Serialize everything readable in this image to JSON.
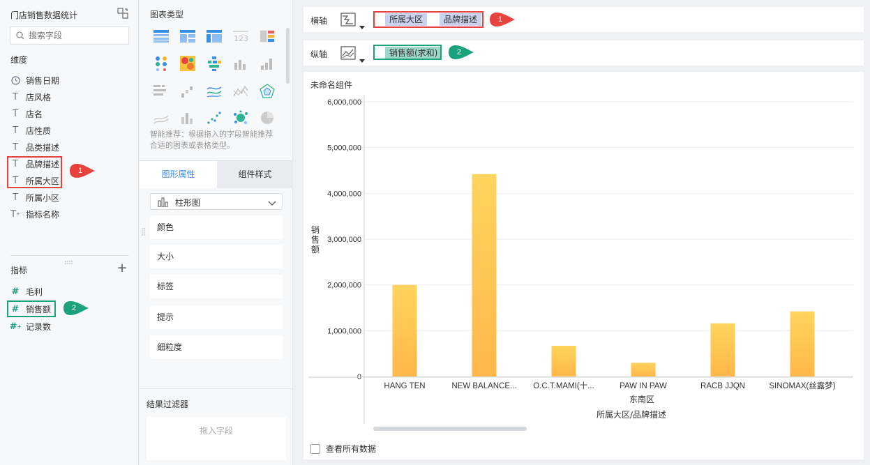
{
  "dataset": {
    "title": "门店销售数据统计"
  },
  "search": {
    "placeholder": "搜索字段"
  },
  "dimensions": {
    "label": "维度",
    "items": [
      {
        "label": "销售日期",
        "icon": "clock-icon"
      },
      {
        "label": "店风格",
        "icon": "text-type-icon"
      },
      {
        "label": "店名",
        "icon": "text-type-icon"
      },
      {
        "label": "店性质",
        "icon": "text-type-icon"
      },
      {
        "label": "品类描述",
        "icon": "text-type-icon"
      },
      {
        "label": "品牌描述",
        "icon": "text-type-icon"
      },
      {
        "label": "所属大区",
        "icon": "text-type-icon"
      },
      {
        "label": "所属小区",
        "icon": "text-type-icon"
      },
      {
        "label": "指标名称",
        "icon": "text-type-icon"
      }
    ]
  },
  "measures": {
    "label": "指标",
    "items": [
      {
        "label": "毛利",
        "icon": "number-type-icon"
      },
      {
        "label": "销售额",
        "icon": "number-type-icon"
      },
      {
        "label": "记录数",
        "icon": "number-type-icon"
      }
    ]
  },
  "badges": {
    "one": "1",
    "two": "2"
  },
  "chart_types": {
    "label": "图表类型",
    "recommend": "智能推荐：根据拖入的字段智能推荐合适的图表或表格类型。"
  },
  "tabs": {
    "graph_props": "图形属性",
    "component_style": "组件样式"
  },
  "chart_select": {
    "value": "柱形图"
  },
  "properties": [
    "颜色",
    "大小",
    "标签",
    "提示",
    "细粒度"
  ],
  "result_filter": {
    "label": "结果过滤器",
    "drop_hint": "拖入字段"
  },
  "x_axis": {
    "label": "横轴",
    "fields": [
      "所属大区",
      "品牌描述"
    ]
  },
  "y_axis": {
    "label": "纵轴",
    "fields": [
      "销售额(求和)"
    ]
  },
  "component": {
    "title": "未命名组件"
  },
  "view_all": {
    "label": "查看所有数据"
  },
  "colors": {
    "bar_top": "#ffd45e",
    "bar_bottom": "#ffb74a",
    "accent": "#3a8ee6",
    "red": "#e8423f",
    "green": "#1ba27d"
  },
  "chart_data": {
    "type": "bar",
    "categories": [
      "HANG TEN",
      "NEW BALANCE...",
      "O.C.T.MAMI(十...",
      "PAW IN PAW",
      "RACB JJQN",
      "SINOMAX(丝露梦)"
    ],
    "group_label": "东南区",
    "values": [
      2000000,
      4420000,
      670000,
      300000,
      1160000,
      1420000
    ],
    "ylim": [
      0,
      6000000
    ],
    "yticks": [
      0,
      1000000,
      2000000,
      3000000,
      4000000,
      5000000,
      6000000
    ],
    "ytick_labels": [
      "0",
      "1,000,000",
      "2,000,000",
      "3,000,000",
      "4,000,000",
      "5,000,000",
      "6,000,000"
    ],
    "ylabel": "销售额",
    "xlabel": "所属大区/品牌描述",
    "grid": true
  }
}
